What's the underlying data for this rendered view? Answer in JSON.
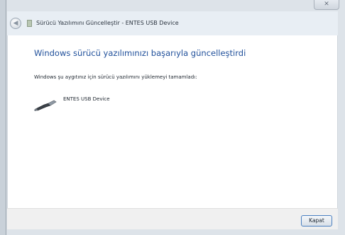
{
  "window": {
    "title": "Sürücü Yazılımını Güncelleştir - ENTES USB Device",
    "close_glyph": "✕"
  },
  "content": {
    "heading": "Windows sürücü yazılımınızı başarıyla güncelleştirdi",
    "message": "Windows şu aygıtınız için sürücü yazılımını yüklemeyi tamamladı:",
    "device_name": "ENTES USB Device",
    "device_icon": "usb-device-icon"
  },
  "footer": {
    "close_button_label": "Kapat"
  }
}
